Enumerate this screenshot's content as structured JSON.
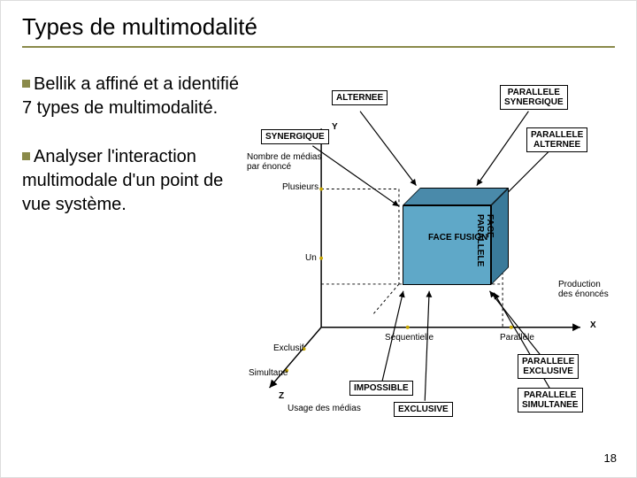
{
  "title": "Types de multimodalité",
  "bullets": [
    "Bellik a affiné et a identifié 7 types de multimodalité.",
    "Analyser l'interaction multimodale d'un point de vue système."
  ],
  "diagram": {
    "nodes": {
      "alternee": "ALTERNEE",
      "parallele_synergique": "PARALLELE\nSYNERGIQUE",
      "synergique": "SYNERGIQUE",
      "parallele_alternee": "PARALLELE\nALTERNEE",
      "impossible": "IMPOSSIBLE",
      "parallele_exclusive": "PARALLELE\nEXCLUSIVE",
      "exclusive": "EXCLUSIVE",
      "parallele_simultanee": "PARALLELE\nSIMULTANEE"
    },
    "cube": {
      "front_label": "FACE\nFUSION",
      "side_label": "FACE\nPARALLELE"
    },
    "axis": {
      "y_title": "Nombre de médias\npar énoncé",
      "y_letter": "Y",
      "y_top": "Plusieurs",
      "y_mid": "Un",
      "x_letter": "X",
      "x_title": "Production\ndes énoncés",
      "x_left": "Séquentielle",
      "x_right": "Parallèle",
      "z_letter": "Z",
      "z_title": "Usage des médias",
      "z_top": "Exclusif",
      "z_bottom": "Simultané"
    }
  },
  "page": "18"
}
